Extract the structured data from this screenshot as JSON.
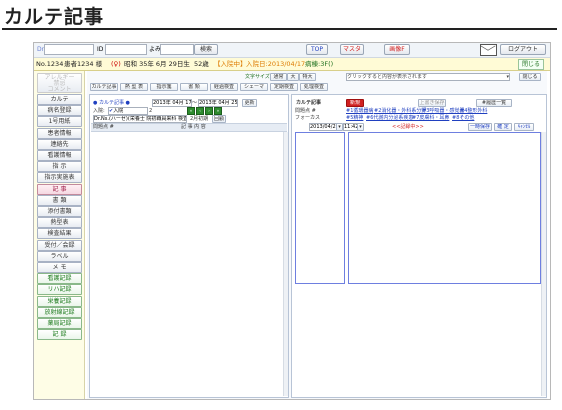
{
  "page": {
    "title": "カルテ記事"
  },
  "topbar": {
    "dr_label": "Dr",
    "id_label": "ID",
    "yomi_label": "よみ",
    "search_label": "検索",
    "top_label": "TOP",
    "master_label": "マスタ",
    "image_label": "画像F",
    "logout_label": "ログアウト"
  },
  "patient": {
    "number": "No.1234",
    "name": "患者1234 様",
    "sex": "(♀)",
    "birth": "昭和 35年 6月 29日生",
    "age": "52歳",
    "admission_status": "【入院中】",
    "admission_date": "入院日:2013/04/17",
    "ward": "病棟:3F()",
    "close_label": "閉じる"
  },
  "sidebar": {
    "top_label": "アレルギー\n禁忌\nコメント",
    "items": [
      {
        "label": "カルテ"
      },
      {
        "label": "病名登録"
      },
      {
        "label": "1号用紙"
      },
      {
        "label": "患者情報"
      },
      {
        "label": "連絡先"
      },
      {
        "label": "看護情報"
      },
      {
        "label": "指 示"
      },
      {
        "label": "指示実施表"
      },
      {
        "label": "記 事"
      },
      {
        "label": "書 類"
      },
      {
        "label": "添付書類"
      },
      {
        "label": "熱型表"
      },
      {
        "label": "検査結果"
      },
      {
        "label": "受付／会録"
      },
      {
        "label": "ラベル"
      },
      {
        "label": "メ モ"
      },
      {
        "label": "看護記録"
      },
      {
        "label": "リハ記録"
      },
      {
        "label": "栄養記録"
      },
      {
        "label": "放射線記録"
      },
      {
        "label": "薬局記録"
      },
      {
        "label": "記 録"
      }
    ]
  },
  "toolbar": {
    "font_size_label": "文字サイズ:",
    "font_sizes": [
      "通常",
      "大",
      "特大"
    ],
    "dropdown_text": "クリックすると内容が表示されます",
    "close2_label": "閉じる",
    "tabs": [
      "カルテ記事",
      "熱 型 表",
      "指示箋",
      "書 類",
      "経過検査",
      "シェーマ",
      "定期検査",
      "処理検査"
    ]
  },
  "left_panel": {
    "heading": "● カルテ記事 ●",
    "date_from": "2013年 04月 17日",
    "date_to": "2013年 04月 25日",
    "update_label": "更新",
    "entry_label": "入院:",
    "days_label": "2",
    "checkbox_label": "入院",
    "filter_value": "Dr.Ns.(ハーゼ)(栄養士 院初職員来科 検査科 薬剤師",
    "date_range_label": "2月初期",
    "flag_label": "回顧",
    "col_date": "問題点 #",
    "col_content": "記 事 内 容"
  },
  "right_panel": {
    "heading": "カルテ記事",
    "new_label": "新規",
    "edit_label": "上書き保存",
    "list_label": "#履歴一覧",
    "problem_label": "問題点 #",
    "focus_label": "フォーカス",
    "links_row1": [
      "#1循環器病",
      "#2消化器・外科系分野",
      "#3呼吸器・感覚器",
      "#4整形外科"
    ],
    "links_row2": [
      "#5精神",
      "#6代謝内分泌系疾患",
      "#7皮膚科・耳鼻",
      "#8その他"
    ],
    "date_value": "2013/04/25",
    "time_value": "11:42",
    "record_marker": "<<記録中>>",
    "temp_save_label": "一時保存",
    "confirm_label": "確 定",
    "cancel_label": "ｷｬﾝｾﾙ"
  }
}
